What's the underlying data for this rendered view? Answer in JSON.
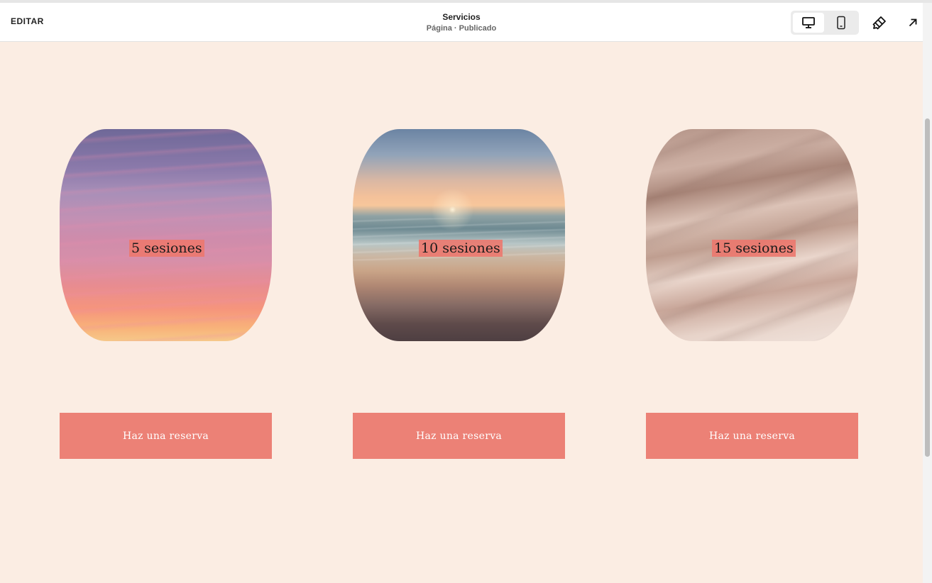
{
  "topbar": {
    "edit_label": "EDITAR",
    "page_title": "Servicios",
    "page_subtitle": "Página · Publicado"
  },
  "icons": {
    "desktop": "desktop-icon",
    "mobile": "mobile-icon",
    "design": "paintbrush-icon",
    "exit": "arrow-up-right-icon"
  },
  "cards": [
    {
      "label": "5 sesiones",
      "button_label": "Haz una reserva",
      "image": "sunset-sky"
    },
    {
      "label": "10 sesiones",
      "button_label": "Haz una reserva",
      "image": "ocean-sunset"
    },
    {
      "label": "15 sesiones",
      "button_label": "Haz una reserva",
      "image": "sand-dunes"
    }
  ],
  "colors": {
    "background": "#fbede3",
    "accent": "#ec8176",
    "button_text": "#ffffff"
  }
}
